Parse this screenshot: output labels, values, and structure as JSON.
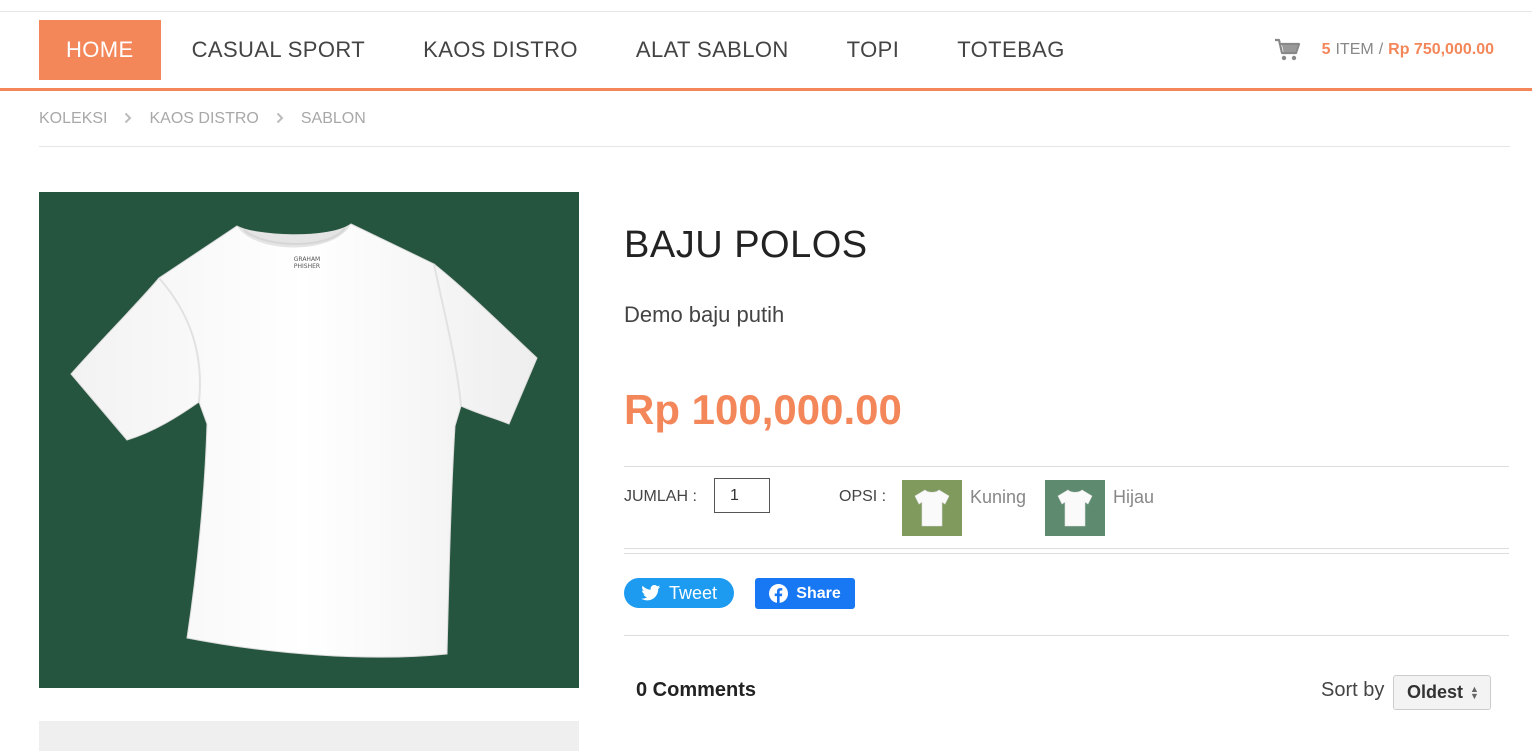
{
  "nav": {
    "items": [
      {
        "label": "HOME",
        "active": true
      },
      {
        "label": "CASUAL SPORT"
      },
      {
        "label": "KAOS DISTRO"
      },
      {
        "label": "ALAT SABLON"
      },
      {
        "label": "TOPI"
      },
      {
        "label": "TOTEBAG"
      }
    ],
    "cart": {
      "icon": "shopping-cart-icon",
      "count": "5",
      "label": "ITEM",
      "separator": "/",
      "total": "Rp 750,000.00"
    }
  },
  "breadcrumb": {
    "items": [
      "KOLEKSI",
      "KAOS DISTRO",
      "SABLON"
    ],
    "separator_icon": "chevron-right-icon"
  },
  "product": {
    "title": "BAJU POLOS",
    "description": "Demo baju putih",
    "price": "Rp 100,000.00",
    "image_background": "#26553f",
    "quantity_label": "JUMLAH :",
    "quantity_value": "1",
    "options_label": "OPSI :",
    "options": [
      {
        "name": "Kuning",
        "swatch_color": "#7f9a5c"
      },
      {
        "name": "Hijau",
        "swatch_color": "#5e8a70"
      }
    ]
  },
  "share": {
    "tweet_label": "Tweet",
    "facebook_label": "Share"
  },
  "comments": {
    "count_label": "0 Comments",
    "sort_label": "Sort by",
    "sort_value": "Oldest"
  },
  "colors": {
    "accent": "#f4875a",
    "twitter": "#1d9bf0",
    "facebook": "#1877f2"
  }
}
